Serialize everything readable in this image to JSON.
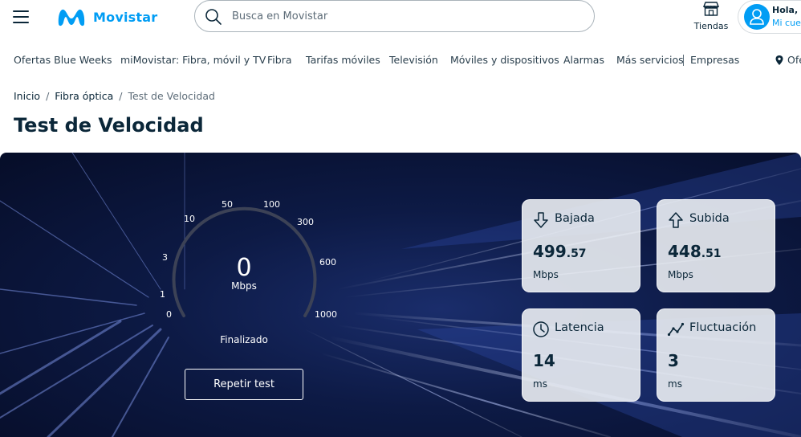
{
  "header": {
    "brand": "Movistar",
    "search_placeholder": "Busca en Movistar",
    "stores_label": "Tiendas",
    "user_greeting": "Hola, Z.",
    "user_account": "Mi cuenta"
  },
  "nav": {
    "items": [
      "Ofertas Blue Weeks",
      "miMovistar: Fibra, móvil y TV",
      "Fibra",
      "Tarifas móviles",
      "Televisión",
      "Móviles y dispositivos",
      "Alarmas",
      "Más servicios",
      "Empresas"
    ],
    "location_label": "Ofertas"
  },
  "breadcrumb": [
    "Inicio",
    "Fibra óptica",
    "Test de Velocidad"
  ],
  "page_title": "Test de Velocidad",
  "speedtest": {
    "gauge_value": "0",
    "gauge_unit": "Mbps",
    "status": "Finalizado",
    "ticks": [
      "0",
      "1",
      "3",
      "10",
      "50",
      "100",
      "300",
      "600",
      "1000"
    ],
    "repeat_button": "Repetir test",
    "download": {
      "title": "Bajada",
      "value_int": "499",
      "value_dec": ".57",
      "unit": "Mbps"
    },
    "upload": {
      "title": "Subida",
      "value_int": "448",
      "value_dec": ".51",
      "unit": "Mbps"
    },
    "latency": {
      "title": "Latencia",
      "value": "14",
      "unit": "ms"
    },
    "jitter": {
      "title": "Fluctuación",
      "value": "3",
      "unit": "ms"
    }
  },
  "colors": {
    "brand": "#019df4",
    "text": "#0b2739",
    "hero_bg": "#0d1a45"
  }
}
